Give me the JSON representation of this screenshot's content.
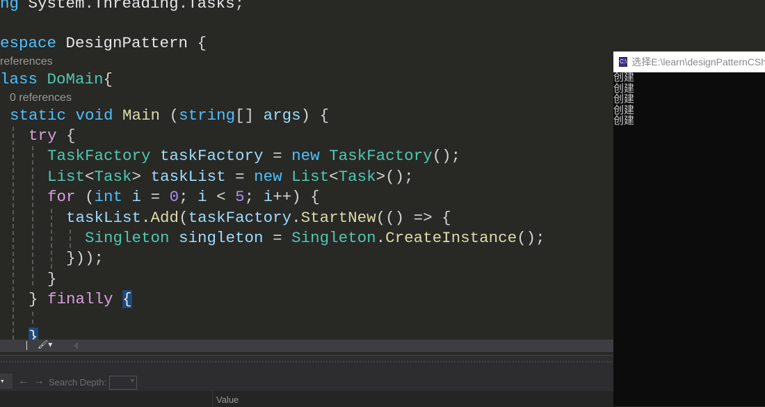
{
  "editor": {
    "code_lens": [
      "references",
      "0 references"
    ],
    "lines": [
      [
        [
          "ng ",
          "kw"
        ],
        [
          "System",
          "pl"
        ],
        [
          ".",
          "pu"
        ],
        [
          "Threading",
          "pl"
        ],
        [
          ".",
          "pu"
        ],
        [
          "Tasks",
          "pl"
        ],
        [
          ";",
          "pu"
        ]
      ],
      [
        [
          "espace ",
          "kw"
        ],
        [
          "DesignPattern",
          "pl"
        ],
        [
          " {",
          "pu"
        ]
      ],
      [
        [
          "lass ",
          "kw"
        ],
        [
          "DoMain",
          "ty"
        ],
        [
          "{",
          "pu"
        ]
      ],
      [
        [
          "static ",
          "kw"
        ],
        [
          "void ",
          "kw"
        ],
        [
          "Main",
          "fn"
        ],
        [
          " (",
          "pu"
        ],
        [
          "string",
          "kw"
        ],
        [
          "[] ",
          "pu"
        ],
        [
          "args",
          "vr"
        ],
        [
          ") {",
          "pu"
        ]
      ],
      [
        [
          "try",
          "ctl"
        ],
        [
          " {",
          "pu"
        ]
      ],
      [
        [
          "TaskFactory ",
          "ty"
        ],
        [
          "taskFactory",
          "vr"
        ],
        [
          " = ",
          "pu"
        ],
        [
          "new ",
          "kw"
        ],
        [
          "TaskFactory",
          "ty"
        ],
        [
          "();",
          "pu"
        ]
      ],
      [
        [
          "List",
          "ty"
        ],
        [
          "<",
          "pu"
        ],
        [
          "Task",
          "ty"
        ],
        [
          "> ",
          "pu"
        ],
        [
          "taskList",
          "vr"
        ],
        [
          " = ",
          "pu"
        ],
        [
          "new ",
          "kw"
        ],
        [
          "List",
          "ty"
        ],
        [
          "<",
          "pu"
        ],
        [
          "Task",
          "ty"
        ],
        [
          ">();",
          "pu"
        ]
      ],
      [
        [
          "for",
          "ctl"
        ],
        [
          " (",
          "pu"
        ],
        [
          "int ",
          "kw"
        ],
        [
          "i",
          "vr"
        ],
        [
          " = ",
          "pu"
        ],
        [
          "0",
          "num"
        ],
        [
          "; ",
          "pu"
        ],
        [
          "i",
          "vr"
        ],
        [
          " < ",
          "pu"
        ],
        [
          "5",
          "num"
        ],
        [
          "; ",
          "pu"
        ],
        [
          "i",
          "vr"
        ],
        [
          "++) {",
          "pu"
        ]
      ],
      [
        [
          "taskList",
          "vr"
        ],
        [
          ".",
          "pu"
        ],
        [
          "Add",
          "fn"
        ],
        [
          "(",
          "pu"
        ],
        [
          "taskFactory",
          "vr"
        ],
        [
          ".",
          "pu"
        ],
        [
          "StartNew",
          "fn"
        ],
        [
          "(() => {",
          "pu"
        ]
      ],
      [
        [
          "Singleton ",
          "ty"
        ],
        [
          "singleton",
          "vr"
        ],
        [
          " = ",
          "pu"
        ],
        [
          "Singleton",
          "ty"
        ],
        [
          ".",
          "pu"
        ],
        [
          "CreateInstance",
          "fn"
        ],
        [
          "();",
          "pu"
        ]
      ],
      [
        [
          "}));",
          "pu"
        ]
      ],
      [
        [
          "}",
          "pu"
        ]
      ],
      [
        [
          "} ",
          "pu"
        ],
        [
          "finally",
          "ctl"
        ],
        [
          " ",
          "pu"
        ],
        [
          "{",
          "br"
        ]
      ],
      [
        [
          "}",
          "br"
        ]
      ]
    ]
  },
  "debug_panel": {
    "search_depth_label": "Search Depth:",
    "search_depth_value": "",
    "value_column": "Value"
  },
  "console": {
    "title": "选择E:\\learn\\designPatternCSharp",
    "icon_text": "C:\\",
    "output": [
      "创建",
      "创建",
      "创建",
      "创建",
      "创建"
    ]
  }
}
